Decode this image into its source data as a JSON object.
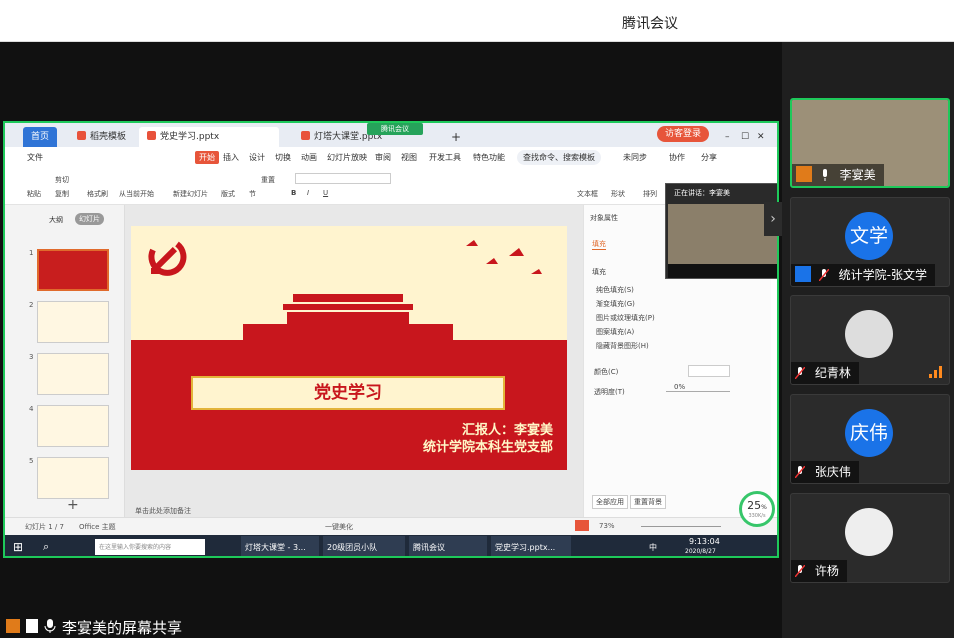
{
  "app_title": "腾讯会议",
  "share_footer": "李宴美的屏幕共享",
  "meeting_badge": "腾讯会议",
  "participants": [
    {
      "name": "李宴美",
      "avatar_text": "",
      "active": true
    },
    {
      "name": "统计学院-张文学",
      "avatar_text": "文学",
      "active": false
    },
    {
      "name": "纪青林",
      "avatar_text": "",
      "active": false
    },
    {
      "name": "张庆伟",
      "avatar_text": "庆伟",
      "active": false
    },
    {
      "name": "许杨",
      "avatar_text": "",
      "active": false
    }
  ],
  "wps": {
    "tabs": [
      "首页",
      "稻壳模板",
      "党史学习.pptx",
      "灯塔大课堂.pptx"
    ],
    "login": "访客登录",
    "menu": [
      "文件",
      "开始",
      "插入",
      "设计",
      "切换",
      "动画",
      "幻灯片放映",
      "审阅",
      "视图",
      "开发工具",
      "特色功能"
    ],
    "search": "查找命令、搜索模板",
    "menu_right": [
      "未同步",
      "协作",
      "分享"
    ],
    "ribbon": [
      "粘贴",
      "剪切",
      "复制",
      "格式刷",
      "从当前开始",
      "新建幻灯片",
      "版式",
      "节",
      "重置",
      "文本框",
      "形状",
      "排列"
    ],
    "side_tabs": [
      "大纲",
      "幻灯片"
    ],
    "thumb_numbers": [
      "1",
      "2",
      "3",
      "4",
      "5"
    ],
    "slide": {
      "title": "党史学习",
      "reporter_line1": "汇报人：李宴美",
      "reporter_line2": "统计学院本科生党支部"
    },
    "props": {
      "title": "对象属性",
      "fill": "填充",
      "fill_section": "填充",
      "options": [
        "纯色填充(S)",
        "渐变填充(G)",
        "图片或纹理填充(P)",
        "图案填充(A)",
        "隐藏背景图形(H)"
      ],
      "color": "颜色(C)",
      "transparency": "透明度(T)",
      "transparency_value": "0%",
      "apply_all": "全部应用",
      "reset": "重置背景"
    },
    "status": {
      "slide_count": "幻灯片 1 / 7",
      "theme": "Office 主题",
      "notes": "单击此处添加备注",
      "beautify": "一键美化",
      "zoom": "73%"
    },
    "mini_video_label": "正在讲话：李宴美",
    "progress": {
      "value": "25",
      "unit": "%",
      "speed": "330K/s"
    }
  },
  "taskbar": {
    "search_placeholder": "在这里输入你要搜索的内容",
    "apps": [
      "灯塔大课堂 - 3...",
      "20级团员小队",
      "腾讯会议",
      "党史学习.pptx..."
    ],
    "ime": "中",
    "time": "9:13:04",
    "date": "2020/8/27"
  }
}
